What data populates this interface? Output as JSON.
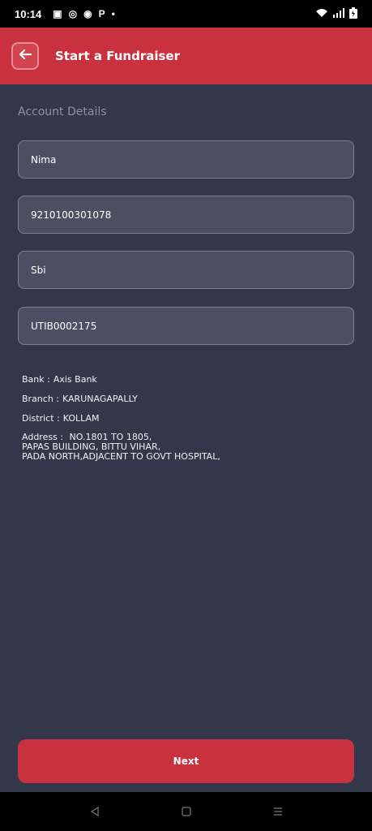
{
  "status_bar": {
    "time": "10:14",
    "left_icons": [
      "message-icon",
      "whatsapp-icon",
      "app-icon",
      "p-icon",
      "dot-icon"
    ],
    "right_icons": [
      "wifi-icon",
      "signal-icon",
      "battery-icon"
    ]
  },
  "app_bar": {
    "title": "Start a Fundraiser"
  },
  "account": {
    "section_title": "Account Details",
    "fields": [
      {
        "name": "account-holder",
        "value": "Nima"
      },
      {
        "name": "account-number",
        "value": "9210100301078"
      },
      {
        "name": "bank-name",
        "value": "Sbi"
      },
      {
        "name": "ifsc",
        "value": "UTIB0002175"
      }
    ],
    "bank_label": "Bank :",
    "bank_value": "Axis Bank",
    "branch_label": "Branch :",
    "branch_value": "KARUNAGAPALLY",
    "district_label": "District :",
    "district_value": "KOLLAM",
    "address_label": "Address :",
    "address_line1": "NO.1801 TO 1805,",
    "address_line2": "PAPAS BUILDING, BITTU VIHAR,",
    "address_line3": "PADA NORTH,ADJACENT TO GOVT HOSPITAL,"
  },
  "actions": {
    "next_label": "Next"
  }
}
